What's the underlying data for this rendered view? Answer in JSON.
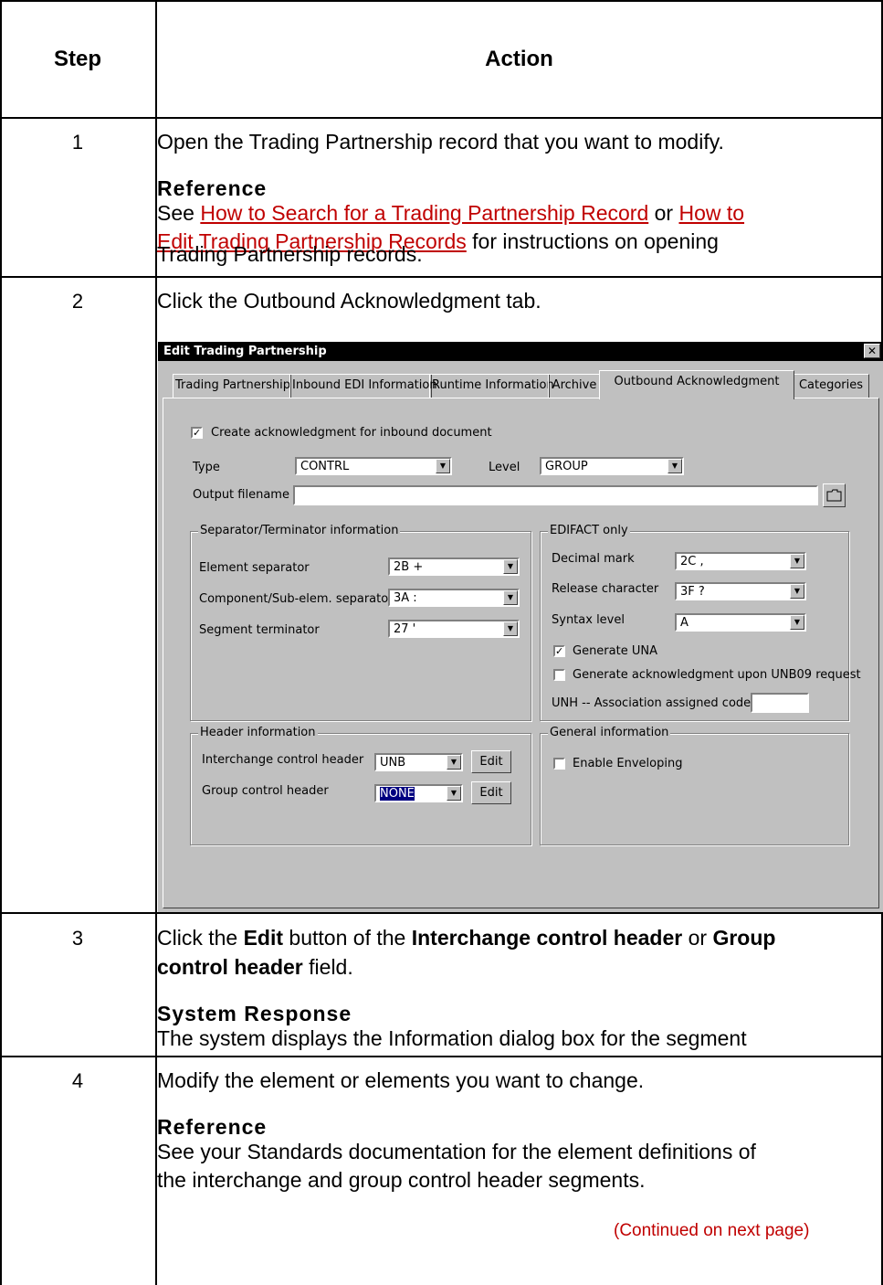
{
  "table": {
    "col_step": "Step",
    "col_action": "Action",
    "rows": [
      {
        "step": "1",
        "text": "Open the Trading Partnership record that you want to modify.",
        "sub_heading": "Reference",
        "ref_prefix": "See ",
        "link1": "How to Search for a Trading Partnership Record",
        "ref_mid": " or ",
        "link2a": "How to ",
        "link2b": "Edit Trading Partnership Records",
        "ref_suffix1": " for instructions on opening",
        "ref_suffix2": "Trading Partnership records."
      },
      {
        "step": "2",
        "text": "Click the Outbound Acknowledgment tab."
      },
      {
        "step": "3",
        "line1_a": "Click the ",
        "line1_b": "Edit",
        "line1_c": " button of the ",
        "line1_d": "Interchange control header",
        "line1_e": " or ",
        "line1_f": "Group",
        "line2_a": "control header",
        "line2_b": " field.",
        "sub_heading": "System Response",
        "response": "The system displays the Information dialog box for the segment"
      },
      {
        "step": "4",
        "text": "Modify the element or elements you want to change.",
        "sub_heading": "Reference",
        "ref_line1": "See your Standards documentation for the element definitions of",
        "ref_line2": "the interchange and group control header segments.",
        "continued": "(Continued on next page)"
      }
    ]
  },
  "dialog": {
    "title": "Edit Trading Partnership",
    "close_glyph": "✕",
    "tabs": [
      "Trading Partnership",
      "Inbound EDI Information",
      "Runtime Information",
      "Archive",
      "Outbound Acknowledgment",
      "Categories"
    ],
    "active_tab": "Outbound Acknowledgment",
    "create_ack": {
      "label": "Create acknowledgment for inbound document",
      "checked": true
    },
    "type_label": "Type",
    "type_value": "CONTRL",
    "level_label": "Level",
    "level_value": "GROUP",
    "output_label": "Output filename",
    "output_value": "",
    "separator_group": {
      "title": "Separator/Terminator information",
      "element_label": "Element separator",
      "element_value": "2B +",
      "component_label": "Component/Sub-elem. separator",
      "component_value": "3A :",
      "segment_label": "Segment terminator",
      "segment_value": "27 '"
    },
    "edifact_group": {
      "title": "EDIFACT only",
      "decimal_label": "Decimal mark",
      "decimal_value": "2C ,",
      "release_label": "Release character",
      "release_value": "3F ?",
      "syntax_label": "Syntax level",
      "syntax_value": "A",
      "gen_una_label": "Generate UNA",
      "gen_una_checked": true,
      "gen_ack_label": "Generate acknowledgment upon UNB09 request",
      "gen_ack_checked": false,
      "unh_label": "UNH -- Association assigned code",
      "unh_value": ""
    },
    "header_group": {
      "title": "Header information",
      "interchange_label": "Interchange control header",
      "interchange_value": "UNB",
      "group_label": "Group control header",
      "group_value": "NONE",
      "edit_label": "Edit"
    },
    "general_group": {
      "title": "General information",
      "enveloping_label": "Enable Enveloping",
      "enveloping_checked": false
    }
  },
  "colors": {
    "link": "#c00000",
    "dialog_face": "#c0c0c0",
    "title_bar": "#000000",
    "selection": "#000080"
  }
}
